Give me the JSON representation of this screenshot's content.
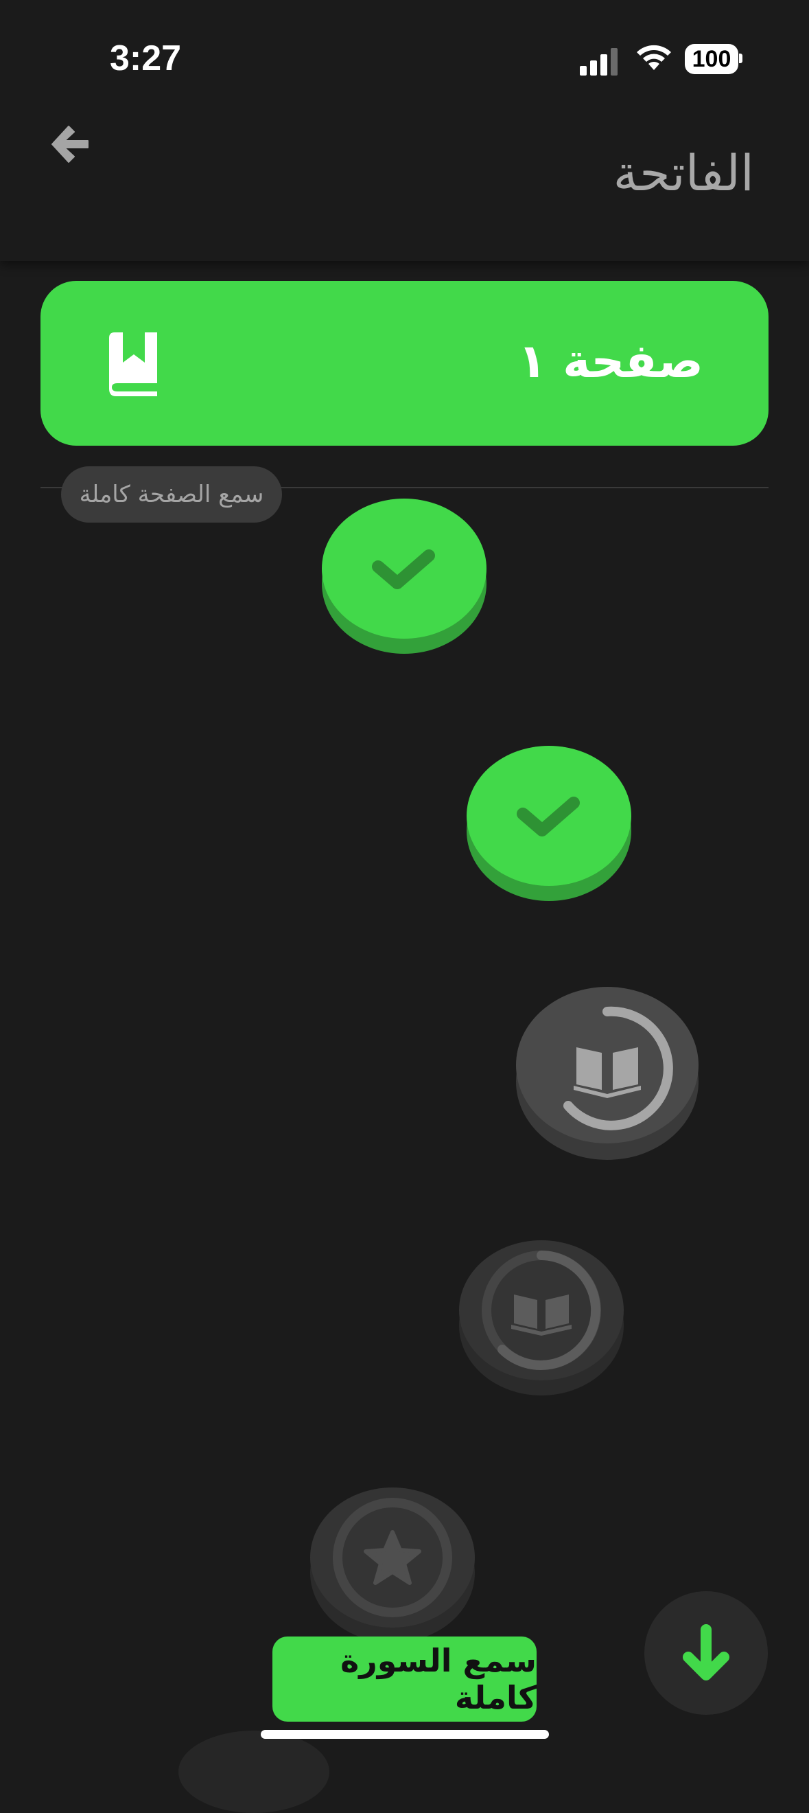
{
  "status_bar": {
    "time": "3:27",
    "battery": "100"
  },
  "header": {
    "title": "الفاتحة",
    "back_icon": "arrow-left-icon"
  },
  "banner": {
    "label": "صفحة ١",
    "icon": "bookmark-book-icon",
    "color": "#42d94a"
  },
  "listen_page_chip": {
    "label": "سمع الصفحة كاملة"
  },
  "path_nodes": [
    {
      "state": "completed",
      "icon": "check-icon"
    },
    {
      "state": "completed",
      "icon": "check-icon"
    },
    {
      "state": "current",
      "icon": "open-book-icon",
      "progress": 0.75
    },
    {
      "state": "locked",
      "icon": "open-book-icon",
      "progress": 0.75
    },
    {
      "state": "locked",
      "icon": "star-icon"
    }
  ],
  "bottom": {
    "listen_surah_label": "سمع السورة كاملة",
    "scroll_down_icon": "arrow-down-icon"
  },
  "colors": {
    "background": "#1b1b1b",
    "accent": "#42d94a",
    "accent_dark": "#33a13a"
  }
}
